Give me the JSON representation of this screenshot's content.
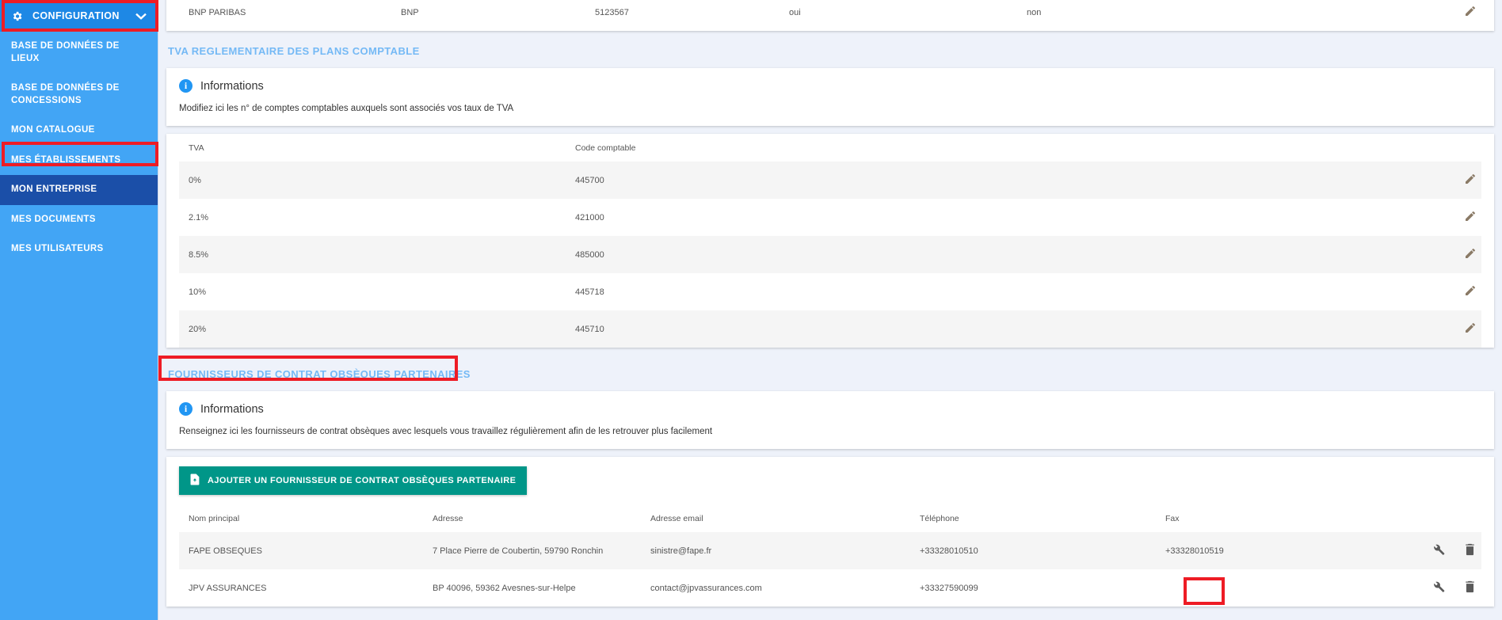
{
  "sidebar": {
    "header": {
      "label": "CONFIGURATION",
      "gear_icon": "gear-icon",
      "chevron_icon": "chevron-down-icon"
    },
    "items": [
      {
        "label": "BASE DE DONNÉES DE LIEUX",
        "active": false
      },
      {
        "label": "BASE DE DONNÉES DE CONCESSIONS",
        "active": false
      },
      {
        "label": "MON CATALOGUE",
        "active": false
      },
      {
        "label": "MES ÉTABLISSEMENTS",
        "active": false
      },
      {
        "label": "MON ENTREPRISE",
        "active": true
      },
      {
        "label": "MES DOCUMENTS",
        "active": false
      },
      {
        "label": "MES UTILISATEURS",
        "active": false
      }
    ]
  },
  "bank_row": {
    "name": "BNP PARIBAS",
    "short": "BNP",
    "account": "5123567",
    "flag1": "oui",
    "flag2": "non",
    "edit_icon": "pencil-icon"
  },
  "tva_section": {
    "title": "TVA REGLEMENTAIRE DES PLANS COMPTABLE",
    "info": {
      "icon": "info-icon",
      "title": "Informations",
      "text": "Modifiez ici les n° de comptes comptables auxquels sont associés vos taux de TVA"
    },
    "table": {
      "headers": [
        "TVA",
        "Code comptable"
      ],
      "rows": [
        {
          "tva": "0%",
          "code": "445700",
          "edit_icon": "pencil-icon"
        },
        {
          "tva": "2.1%",
          "code": "421000",
          "edit_icon": "pencil-icon"
        },
        {
          "tva": "8.5%",
          "code": "485000",
          "edit_icon": "pencil-icon"
        },
        {
          "tva": "10%",
          "code": "445718",
          "edit_icon": "pencil-icon"
        },
        {
          "tva": "20%",
          "code": "445710",
          "edit_icon": "pencil-icon"
        }
      ]
    }
  },
  "fournisseurs_section": {
    "title": "FOURNISSEURS DE CONTRAT OBSÈQUES PARTENAIRES",
    "info": {
      "icon": "info-icon",
      "title": "Informations",
      "text": "Renseignez ici les fournisseurs de contrat obsèques avec lesquels vous travaillez régulièrement afin de les retrouver plus facilement"
    },
    "add_button": {
      "label": "AJOUTER UN FOURNISSEUR DE CONTRAT OBSÈQUES PARTENAIRE",
      "icon": "document-add-icon"
    },
    "table": {
      "headers": [
        "Nom principal",
        "Adresse",
        "Adresse email",
        "Téléphone",
        "Fax"
      ],
      "rows": [
        {
          "nom": "FAPE OBSEQUES",
          "adresse": "7 Place Pierre de Coubertin, 59790 Ronchin",
          "email": "sinistre@fape.fr",
          "telephone": "+33328010510",
          "fax": "+33328010519",
          "wrench_icon": "wrench-icon",
          "trash_icon": "trash-icon"
        },
        {
          "nom": "JPV ASSURANCES",
          "adresse": "BP 40096, 59362 Avesnes-sur-Helpe",
          "email": "contact@jpvassurances.com",
          "telephone": "+33327590099",
          "fax": "",
          "wrench_icon": "wrench-icon",
          "trash_icon": "trash-icon"
        }
      ]
    }
  },
  "colors": {
    "sidebar_bg": "#42a5f5",
    "sidebar_header": "#1e88e5",
    "sidebar_active": "#1b4fa8",
    "section_title": "#74b9f5",
    "page_bg": "#eef2fa",
    "accent_green": "#009688",
    "highlight_red": "#ee1c25",
    "info_blue": "#2196f3"
  }
}
